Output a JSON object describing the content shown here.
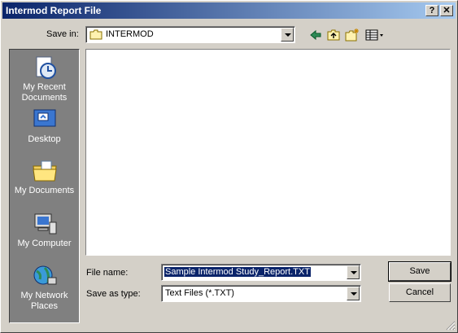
{
  "window": {
    "title": "Intermod Report File"
  },
  "titlebar": {
    "help_label": "?",
    "close_label": "✕"
  },
  "savein": {
    "label": "Save in:",
    "value": "INTERMOD"
  },
  "places": [
    {
      "label": "My Recent Documents"
    },
    {
      "label": "Desktop"
    },
    {
      "label": "My Documents"
    },
    {
      "label": "My Computer"
    },
    {
      "label": "My Network Places"
    }
  ],
  "filename": {
    "label": "File name:",
    "value": "Sample Intermod Study_Report.TXT"
  },
  "savetype": {
    "label": "Save as type:",
    "value": "Text Files (*.TXT)"
  },
  "buttons": {
    "save": "Save",
    "cancel": "Cancel"
  },
  "colors": {
    "title_start": "#0a246a",
    "title_end": "#a6caf0",
    "face": "#d4d0c8",
    "places_bg": "#808080"
  }
}
